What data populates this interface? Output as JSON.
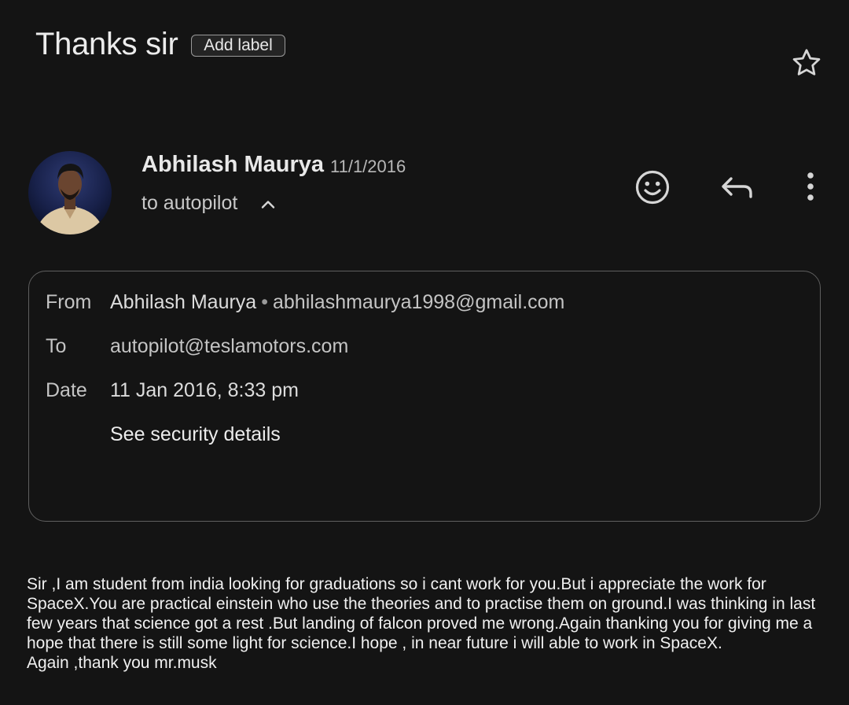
{
  "email": {
    "subject": "Thanks sir",
    "add_label": "Add label",
    "sender": {
      "name": "Abhilash Maurya",
      "date": "11/1/2016",
      "recipient_line": "to autopilot"
    },
    "details": {
      "from_label": "From",
      "from_name": "Abhilash Maurya",
      "from_separator": "•",
      "from_email": "abhilashmaurya1998@gmail.com",
      "to_label": "To",
      "to_value": "autopilot@teslamotors.com",
      "date_label": "Date",
      "date_value": "11 Jan 2016, 8:33 pm",
      "security_link": "See security details"
    },
    "body": [
      "Sir ,I am student from india looking for graduations so i cant work for you.But i appreciate the work for SpaceX.You are practical einstein who use the theories and to practise them on ground.I was thinking in last few years that science got a rest .But landing of falcon  proved me wrong.Again thanking you for giving me a hope that there is still some light for science.I hope , in near future i will able to work in SpaceX.",
      "Again ,thank you mr.musk"
    ]
  },
  "icons": {
    "star": "star-icon",
    "chevron": "chevron-up-icon",
    "emoji": "emoji-icon",
    "reply": "reply-icon",
    "more": "more-icon"
  },
  "colors": {
    "background": "#141414",
    "text": "#e3e3e3",
    "border": "#5f5f5f"
  }
}
